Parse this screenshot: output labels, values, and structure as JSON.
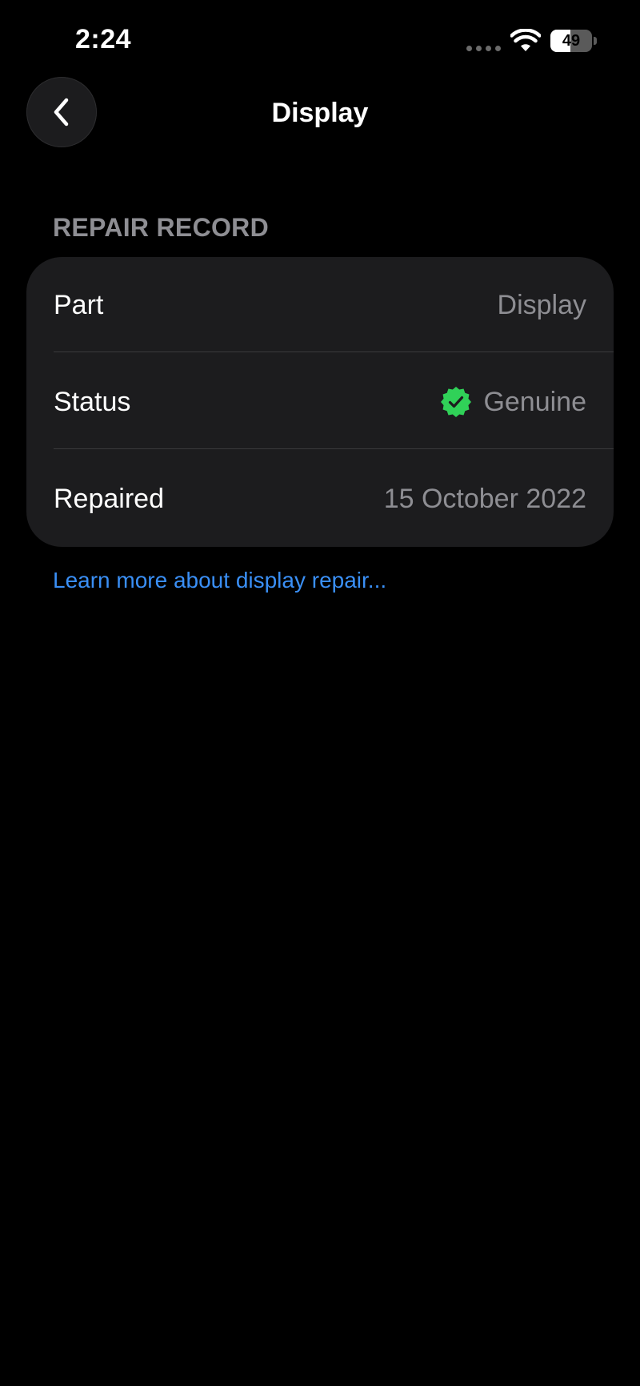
{
  "status_bar": {
    "time": "2:24",
    "battery_level": "49",
    "battery_fraction": 0.49
  },
  "nav": {
    "title": "Display",
    "back_icon": "chevron-left-icon"
  },
  "section": {
    "header": "REPAIR RECORD"
  },
  "rows": [
    {
      "label": "Part",
      "value": "Display"
    },
    {
      "label": "Status",
      "value": "Genuine",
      "icon": "verified-checkmark-icon",
      "icon_color": "#30d158"
    },
    {
      "label": "Repaired",
      "value": "15 October 2022"
    }
  ],
  "link": {
    "text": "Learn more about display repair..."
  },
  "colors": {
    "background": "#000000",
    "card": "#1c1c1e",
    "secondary_text": "#8e8e93",
    "link": "#3a8ff5",
    "verified": "#30d158"
  }
}
